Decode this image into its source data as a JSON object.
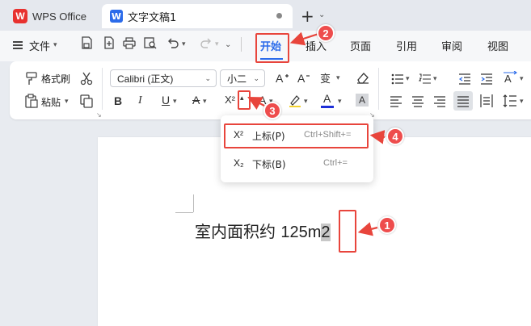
{
  "titlebar": {
    "app_name": "WPS Office",
    "app_logo": "W",
    "doc_tab_label": "文字文稿1",
    "doc_logo": "W",
    "new_tab": "+",
    "new_tab_chevron": "⌄"
  },
  "menubar": {
    "file_label": "文件",
    "tabs": [
      "开始",
      "插入",
      "页面",
      "引用",
      "审阅",
      "视图"
    ],
    "active_tab": "开始"
  },
  "ribbon": {
    "format_painter": "格式刷",
    "paste": "粘贴",
    "font_name": "Calibri (正文)",
    "font_size": "小二",
    "bold": "B",
    "italic": "I",
    "underline": "U",
    "strike": "A",
    "superscript": "X²",
    "font_color_letter": "A",
    "char_shade": "A"
  },
  "popup": {
    "superscript_icon": "X²",
    "superscript_label": "上标(P)",
    "superscript_shortcut": "Ctrl+Shift+=",
    "subscript_icon": "X₂",
    "subscript_label": "下标(B)",
    "subscript_shortcut": "Ctrl+="
  },
  "document": {
    "text_main": "室内面积约 ",
    "text_number": "125m",
    "text_selected": "2"
  },
  "annotations": {
    "badges": [
      "1",
      "2",
      "3",
      "4"
    ]
  },
  "colors": {
    "accent": "#2b6bea",
    "annotation_red": "#e8453c",
    "wps_red": "#e8312f"
  }
}
